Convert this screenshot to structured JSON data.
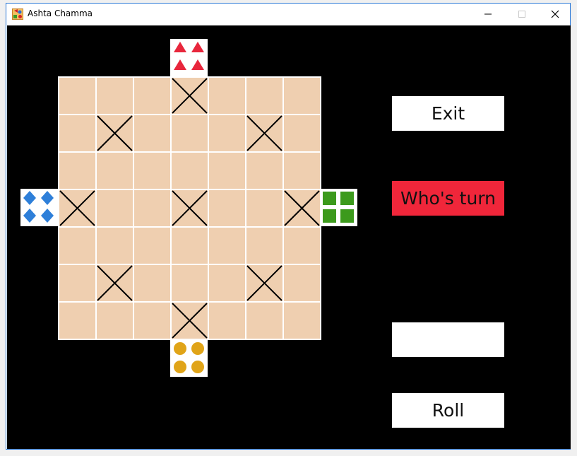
{
  "window": {
    "title": "Ashta Chamma",
    "controls": [
      "minimize",
      "maximize",
      "close"
    ]
  },
  "colors": {
    "board_background": "#000000",
    "cell": "#efcfb0",
    "grid_line": "#ffffff",
    "turn_indicator": "#f0263a",
    "red_player": "#e8263c",
    "blue_player": "#2e7fd9",
    "green_player": "#3c9a1c",
    "yellow_player": "#e0a418"
  },
  "board": {
    "rows": 7,
    "cols": 7,
    "safe_squares": [
      [
        0,
        3
      ],
      [
        1,
        1
      ],
      [
        1,
        5
      ],
      [
        3,
        0
      ],
      [
        3,
        3
      ],
      [
        3,
        6
      ],
      [
        5,
        1
      ],
      [
        5,
        5
      ],
      [
        6,
        3
      ]
    ]
  },
  "players": [
    {
      "name": "red",
      "shape": "triangle-icon",
      "pieces": 4
    },
    {
      "name": "blue",
      "shape": "diamond-icon",
      "pieces": 4
    },
    {
      "name": "green",
      "shape": "square-icon",
      "pieces": 4
    },
    {
      "name": "yellow",
      "shape": "circle-icon",
      "pieces": 4
    }
  ],
  "controls": {
    "exit_label": "Exit",
    "turn_label": "Who's turn",
    "dice_value": "",
    "roll_label": "Roll"
  }
}
